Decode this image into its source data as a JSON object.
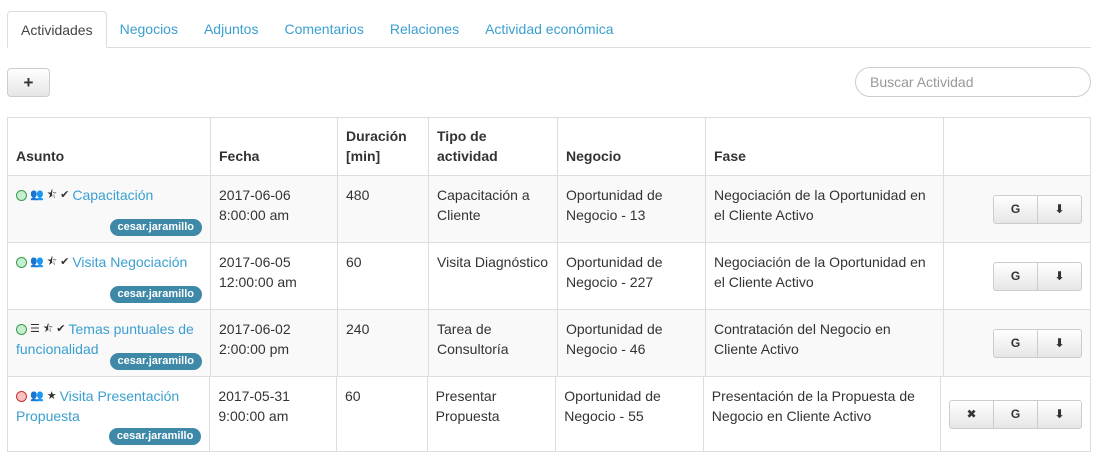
{
  "tabs": [
    "Actividades",
    "Negocios",
    "Adjuntos",
    "Comentarios",
    "Relaciones",
    "Actividad económica"
  ],
  "toolbar": {
    "add_label": "+",
    "search_placeholder": "Buscar Actividad"
  },
  "table": {
    "headers": [
      "Asunto",
      "Fecha",
      "Duración [min]",
      "Tipo de actividad",
      "Negocio",
      "Fase"
    ],
    "rows": [
      {
        "status": "green",
        "type_icon": "users",
        "star": "half",
        "check": true,
        "subject": "Capacitación",
        "owner": "cesar.jaramillo",
        "date_line1": "2017-06-06",
        "date_line2": "8:00:00 am",
        "duration": "480",
        "activity_type": "Capacitación a Cliente",
        "deal": "Oportunidad de Negocio - 13",
        "phase": "Negociación de la Oportunidad en el Cliente Activo",
        "actions": [
          "G",
          "download"
        ]
      },
      {
        "status": "green",
        "type_icon": "users",
        "star": "half",
        "check": true,
        "subject": "Visita Negociación",
        "owner": "cesar.jaramillo",
        "date_line1": "2017-06-05",
        "date_line2": "12:00:00 am",
        "duration": "60",
        "activity_type": "Visita Diagnóstico",
        "deal": "Oportunidad de Negocio - 227",
        "phase": "Negociación de la Oportunidad en el Cliente Activo",
        "actions": [
          "G",
          "download"
        ]
      },
      {
        "status": "green",
        "type_icon": "list",
        "star": "half",
        "check": true,
        "subject": "Temas puntuales de funcionalidad",
        "owner": "cesar.jaramillo",
        "date_line1": "2017-06-02",
        "date_line2": "2:00:00 pm",
        "duration": "240",
        "activity_type": "Tarea de Consultoría",
        "deal": "Oportunidad de Negocio - 46",
        "phase": "Contratación del Negocio en Cliente Activo",
        "actions": [
          "G",
          "download"
        ]
      },
      {
        "status": "red",
        "type_icon": "users",
        "star": "full",
        "check": false,
        "subject": "Visita Presentación Propuesta",
        "owner": "cesar.jaramillo",
        "date_line1": "2017-05-31",
        "date_line2": "9:00:00 am",
        "duration": "60",
        "activity_type": "Presentar Propuesta",
        "deal": "Oportunidad de Negocio - 55",
        "phase": "Presentación de la Propuesta de Negocio en Cliente Activo",
        "actions": [
          "close",
          "G",
          "download"
        ]
      }
    ]
  },
  "action_glyphs": {
    "G": "G",
    "close": "✖",
    "download": "⬇"
  },
  "colors": {
    "link": "#3a9fd0",
    "badge": "#3e88a8",
    "status_green": "#3c9b4f",
    "status_red": "#c9302c"
  }
}
